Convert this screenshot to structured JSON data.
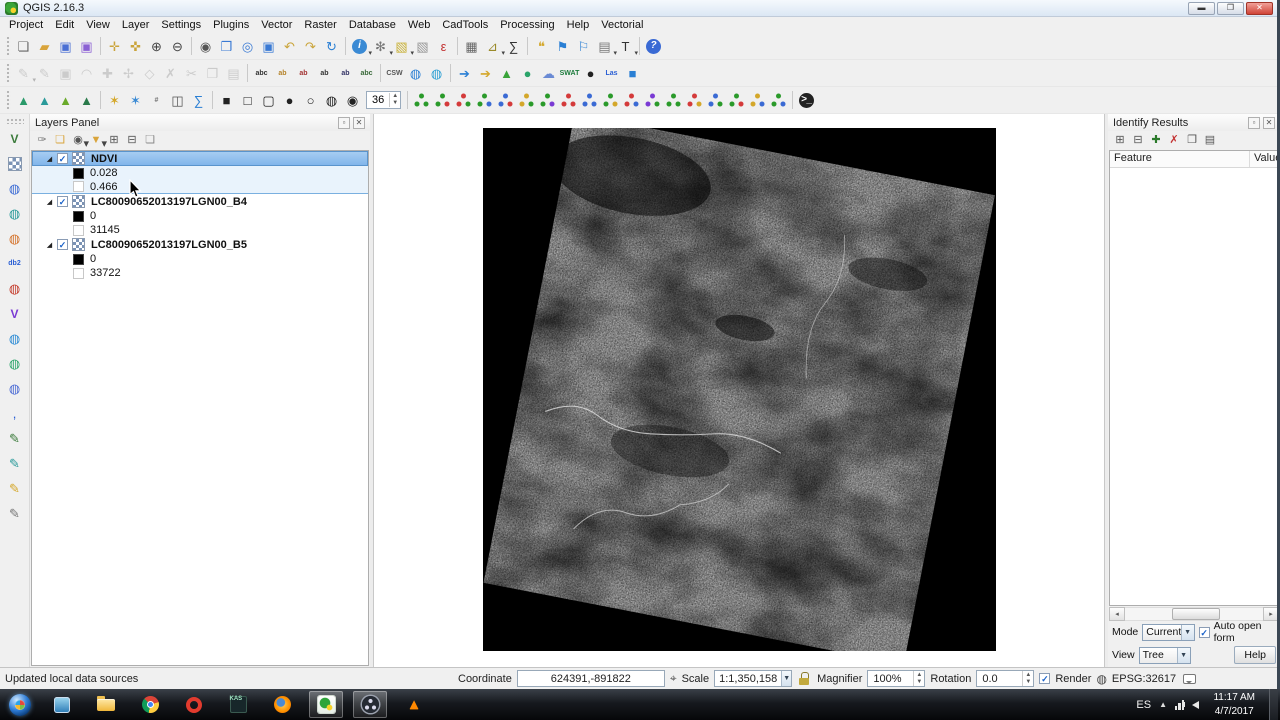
{
  "window": {
    "title": "QGIS 2.16.3"
  },
  "menu": [
    "Project",
    "Edit",
    "View",
    "Layer",
    "Settings",
    "Plugins",
    "Vector",
    "Raster",
    "Database",
    "Web",
    "CadTools",
    "Processing",
    "Help",
    "Vectorial"
  ],
  "colors": {
    "accent": "#2a7fd4",
    "selection": "#7fb4ea",
    "close_button": "#cf4437"
  },
  "toolbars": {
    "row1": [
      {
        "grip": true
      },
      {
        "n": "new-project",
        "g": "❏",
        "c": "#666"
      },
      {
        "n": "open-project",
        "g": "▰",
        "c": "#d9a43b"
      },
      {
        "n": "save-project",
        "g": "▣",
        "c": "#4a6fd4"
      },
      {
        "n": "save-project-as",
        "g": "▣",
        "c": "#8a5fd4"
      },
      {
        "sep": true
      },
      {
        "n": "pan-map",
        "g": "✛",
        "c": "#caa43a"
      },
      {
        "n": "pan-to-selection",
        "g": "✜",
        "c": "#caa43a"
      },
      {
        "n": "zoom-in",
        "g": "⊕",
        "c": "#444"
      },
      {
        "n": "zoom-out",
        "g": "⊖",
        "c": "#444"
      },
      {
        "sep": true
      },
      {
        "n": "zoom-native",
        "g": "◉",
        "c": "#555"
      },
      {
        "n": "zoom-full",
        "g": "❒",
        "c": "#3a7ad4"
      },
      {
        "n": "zoom-to-selection",
        "g": "◎",
        "c": "#3a7ad4"
      },
      {
        "n": "zoom-to-layer",
        "g": "▣",
        "c": "#3a7ad4"
      },
      {
        "n": "zoom-last",
        "g": "↶",
        "c": "#caa43a"
      },
      {
        "n": "zoom-next",
        "g": "↷",
        "c": "#caa43a"
      },
      {
        "n": "refresh-map",
        "g": "↻",
        "c": "#2a7fd4"
      },
      {
        "sep": true
      },
      {
        "n": "identify-features",
        "g": "i",
        "c": "#ffffff",
        "bg": "#3a8ad4",
        "dd": true
      },
      {
        "n": "run-feature-action",
        "g": "✻",
        "c": "#777",
        "dd": true
      },
      {
        "n": "select-features",
        "g": "▧",
        "c": "#c9b23a",
        "dd": true
      },
      {
        "n": "deselect-features",
        "g": "▧",
        "c": "#999"
      },
      {
        "n": "select-by-expression",
        "g": "ε",
        "c": "#c33333"
      },
      {
        "sep": true
      },
      {
        "n": "open-attribute-table",
        "g": "▦",
        "c": "#666"
      },
      {
        "n": "measure-line",
        "g": "⊿",
        "c": "#9a8a2a",
        "dd": true
      },
      {
        "n": "statistical-summary",
        "g": "∑",
        "c": "#333"
      },
      {
        "sep": true
      },
      {
        "n": "map-tips",
        "g": "❝",
        "c": "#d4a72a"
      },
      {
        "n": "new-bookmark",
        "g": "⚑",
        "c": "#2a7fd4"
      },
      {
        "n": "show-bookmarks",
        "g": "⚐",
        "c": "#2a7fd4"
      },
      {
        "n": "new-print-composer",
        "g": "▤",
        "c": "#777",
        "dd": true
      },
      {
        "n": "text-annotation",
        "g": "T",
        "c": "#333",
        "dd": true
      },
      {
        "sep": true
      },
      {
        "n": "help",
        "g": "?",
        "c": "#ffffff",
        "bg": "#3a6ad4"
      }
    ],
    "row2": [
      {
        "grip": true
      },
      {
        "n": "current-edits",
        "g": "✎",
        "c": "#888",
        "dis": true,
        "dd": true
      },
      {
        "n": "toggle-editing",
        "g": "✎",
        "c": "#888",
        "dis": true
      },
      {
        "n": "save-layer-edits",
        "g": "▣",
        "c": "#888",
        "dis": true
      },
      {
        "n": "digitize-with-curve",
        "g": "◠",
        "c": "#888",
        "dis": true
      },
      {
        "n": "add-feature",
        "g": "✚",
        "c": "#888",
        "dis": true
      },
      {
        "n": "move-feature",
        "g": "✢",
        "c": "#888",
        "dis": true
      },
      {
        "n": "node-tool",
        "g": "◇",
        "c": "#888",
        "dis": true
      },
      {
        "n": "delete-selected",
        "g": "✗",
        "c": "#888",
        "dis": true
      },
      {
        "n": "cut-features",
        "g": "✂",
        "c": "#888",
        "dis": true
      },
      {
        "n": "copy-features",
        "g": "❐",
        "c": "#888",
        "dis": true
      },
      {
        "n": "paste-features",
        "g": "▤",
        "c": "#888",
        "dis": true
      },
      {
        "sep": true
      },
      {
        "n": "layer-labeling",
        "g": "abc",
        "txt": true,
        "c": "#333"
      },
      {
        "n": "pin-labels",
        "g": "ab",
        "txt": true,
        "c": "#b5832a"
      },
      {
        "n": "highlight-labels",
        "g": "ab",
        "txt": true,
        "c": "#a33333"
      },
      {
        "n": "move-label",
        "g": "ab",
        "txt": true,
        "c": "#333"
      },
      {
        "n": "rotate-label",
        "g": "ab",
        "txt": true,
        "c": "#336"
      },
      {
        "n": "change-label",
        "g": "abc",
        "txt": true,
        "c": "#3a6a3a"
      },
      {
        "sep": true
      },
      {
        "n": "csw-catalog",
        "g": "CSW",
        "txt": true,
        "c": "#555"
      },
      {
        "n": "metasearch",
        "g": "◍",
        "c": "#2a7fd4"
      },
      {
        "n": "metasearch-services",
        "g": "◍",
        "c": "#2a9fd4"
      },
      {
        "sep": true
      },
      {
        "n": "plugin-import",
        "g": "➔",
        "c": "#2a7fd4"
      },
      {
        "n": "plugin-export",
        "g": "➔",
        "c": "#d4a72a"
      },
      {
        "n": "qgis2web-plugin",
        "g": "▲",
        "c": "#3aa43a"
      },
      {
        "n": "globe-plugin",
        "g": "●",
        "c": "#2aa46a"
      },
      {
        "n": "cloud-plugin",
        "g": "☁",
        "c": "#6a8ad4"
      },
      {
        "n": "swat-plugin",
        "g": "SWAT",
        "txt": true,
        "c": "#1a7a3a"
      },
      {
        "n": "osm-plugin",
        "g": "●",
        "c": "#222"
      },
      {
        "n": "lastools-plugin",
        "g": "Las",
        "txt": true,
        "c": "#2a5fd4"
      },
      {
        "n": "fusion-plugin",
        "g": "■",
        "c": "#2a7fd4"
      }
    ],
    "row3": [
      {
        "grip": true
      },
      {
        "n": "interpolation-tin",
        "g": "▲",
        "c": "#2a9a6a"
      },
      {
        "n": "interpolation-idw",
        "g": "▲",
        "c": "#2a9a9a"
      },
      {
        "n": "terrain-slope",
        "g": "▲",
        "c": "#6aaa2a"
      },
      {
        "n": "terrain-hillshade",
        "g": "▲",
        "c": "#2a7a4a"
      },
      {
        "sep": true
      },
      {
        "n": "heatmap-tool",
        "g": "✶",
        "c": "#d4a72a"
      },
      {
        "n": "zonal-statistics",
        "g": "✶",
        "c": "#3a8ad4"
      },
      {
        "n": "grid-tool",
        "g": "#",
        "txt": true,
        "c": "#777"
      },
      {
        "n": "raster-cube",
        "g": "◫",
        "c": "#555"
      },
      {
        "n": "raster-sum",
        "g": "∑",
        "c": "#2a7fd4"
      },
      {
        "sep": true
      },
      {
        "n": "draw-rect-filled",
        "g": "■",
        "c": "#222"
      },
      {
        "n": "draw-rect",
        "g": "□",
        "c": "#222"
      },
      {
        "n": "draw-rounded-rect",
        "g": "▢",
        "c": "#222"
      },
      {
        "n": "draw-ellipse-filled",
        "g": "●",
        "c": "#222"
      },
      {
        "n": "draw-ellipse",
        "g": "○",
        "c": "#222"
      },
      {
        "n": "draw-circle",
        "g": "◍",
        "c": "#222"
      },
      {
        "n": "draw-spiral",
        "g": "◉",
        "c": "#222"
      },
      {
        "spin": "36",
        "n": "angle-spinbox"
      },
      {
        "sep": true
      },
      {
        "n": "geometry-tool-1",
        "dots": true,
        "c1": "#2a9a2a",
        "c2": "#2a9a2a"
      },
      {
        "n": "geometry-tool-2",
        "dots": true,
        "c1": "#2a9a2a",
        "c2": "#d43a3a"
      },
      {
        "n": "geometry-tool-3",
        "dots": true,
        "c1": "#d43a3a",
        "c2": "#2a9a2a"
      },
      {
        "n": "geometry-tool-4",
        "dots": true,
        "c1": "#2a9a2a",
        "c2": "#3a6ad4"
      },
      {
        "n": "geometry-tool-5",
        "dots": true,
        "c1": "#3a6ad4",
        "c2": "#d43a3a"
      },
      {
        "n": "geometry-tool-6",
        "dots": true,
        "c1": "#d4a72a",
        "c2": "#2a9a2a"
      },
      {
        "n": "geometry-tool-7",
        "dots": true,
        "c1": "#2a9a2a",
        "c2": "#7a3ad4"
      },
      {
        "n": "geometry-tool-8",
        "dots": true,
        "c1": "#d43a3a",
        "c2": "#d43a3a"
      },
      {
        "n": "geometry-tool-9",
        "dots": true,
        "c1": "#3a6ad4",
        "c2": "#3a6ad4"
      },
      {
        "n": "geometry-tool-10",
        "dots": true,
        "c1": "#2a9a2a",
        "c2": "#d4a72a"
      },
      {
        "n": "geometry-tool-11",
        "dots": true,
        "c1": "#d43a3a",
        "c2": "#3a6ad4"
      },
      {
        "n": "geometry-tool-12",
        "dots": true,
        "c1": "#7a3ad4",
        "c2": "#2a9a2a"
      },
      {
        "n": "geometry-tool-13",
        "dots": true,
        "c1": "#2a9a2a",
        "c2": "#2a9a2a"
      },
      {
        "n": "geometry-tool-14",
        "dots": true,
        "c1": "#d43a3a",
        "c2": "#d4a72a"
      },
      {
        "n": "geometry-tool-15",
        "dots": true,
        "c1": "#3a6ad4",
        "c2": "#2a9a2a"
      },
      {
        "n": "geometry-tool-16",
        "dots": true,
        "c1": "#2a9a2a",
        "c2": "#d43a3a"
      },
      {
        "n": "geometry-tool-17",
        "dots": true,
        "c1": "#d4a72a",
        "c2": "#3a6ad4"
      },
      {
        "n": "geometry-tool-18",
        "dots": true,
        "c1": "#2a9a2a",
        "c2": "#3a6ad4"
      },
      {
        "sep": true
      },
      {
        "n": "python-console",
        "g": ">_",
        "txt": true,
        "c": "#ffffff",
        "bg": "#222222"
      }
    ],
    "left": [
      {
        "n": "add-vector-layer",
        "g": "V",
        "txt2": true,
        "c": "#3a7a3a"
      },
      {
        "n": "add-raster-layer",
        "checker": true
      },
      {
        "n": "add-postgis-layer",
        "g": "◍",
        "c": "#3a6ad4"
      },
      {
        "n": "add-spatialite-layer",
        "g": "◍",
        "c": "#2a9a9a"
      },
      {
        "n": "add-mssql-layer",
        "g": "◍",
        "c": "#d4722a"
      },
      {
        "n": "add-db2-layer",
        "g": "db2",
        "txt": true,
        "c": "#2a5fd4"
      },
      {
        "n": "add-oracle-layer",
        "g": "◍",
        "c": "#c43a2a"
      },
      {
        "n": "add-virtual-layer",
        "g": "V",
        "txt2": true,
        "c": "#7a3ad4"
      },
      {
        "n": "add-wms-layer",
        "g": "◍",
        "c": "#2a8ad4"
      },
      {
        "n": "add-wcs-layer",
        "g": "◍",
        "c": "#2aa46a"
      },
      {
        "n": "add-wfs-layer",
        "g": "◍",
        "c": "#4a6ad4"
      },
      {
        "n": "add-delimited-text-layer",
        "g": ",",
        "c": "#2a5fd4"
      },
      {
        "n": "new-shapefile-layer",
        "g": "✎",
        "c": "#3a7a3a"
      },
      {
        "n": "new-spatialite-layer",
        "g": "✎",
        "c": "#2a9a9a"
      },
      {
        "n": "new-geopackage-layer",
        "g": "✎",
        "c": "#d4a72a"
      },
      {
        "n": "new-memory-layer",
        "g": "✎",
        "c": "#777"
      }
    ]
  },
  "layers_panel": {
    "title": "Layers Panel",
    "toolbar": [
      {
        "n": "open-layer-styling",
        "g": "✑",
        "c": "#777"
      },
      {
        "n": "add-group",
        "g": "❏",
        "c": "#d9a43b"
      },
      {
        "n": "manage-visibility",
        "g": "◉",
        "c": "#555",
        "dd": true
      },
      {
        "n": "filter-legend",
        "g": "▼",
        "c": "#d9a43b",
        "dd": true
      },
      {
        "n": "expand-all",
        "g": "⊞",
        "c": "#555"
      },
      {
        "n": "collapse-all",
        "g": "⊟",
        "c": "#555"
      },
      {
        "n": "remove-layer",
        "g": "❏",
        "c": "#888"
      }
    ],
    "layers": [
      {
        "name": "NDVI",
        "checked": true,
        "selected": true,
        "legend": [
          {
            "swatch": "#000000",
            "value": "0.028"
          },
          {
            "swatch": "#ffffff",
            "value": "0.466"
          }
        ]
      },
      {
        "name": "LC80090652013197LGN00_B4",
        "checked": true,
        "selected": false,
        "legend": [
          {
            "swatch": "#000000",
            "value": "0"
          },
          {
            "swatch": "#ffffff",
            "value": "31145"
          }
        ]
      },
      {
        "name": "LC80090652013197LGN00_B5",
        "checked": true,
        "selected": false,
        "legend": [
          {
            "swatch": "#000000",
            "value": "0"
          },
          {
            "swatch": "#ffffff",
            "value": "33722"
          }
        ]
      }
    ]
  },
  "identify_panel": {
    "title": "Identify Results",
    "toolbar": [
      {
        "n": "expand-tree",
        "g": "⊞",
        "c": "#555"
      },
      {
        "n": "collapse-tree",
        "g": "⊟",
        "c": "#555"
      },
      {
        "n": "expand-new-results",
        "g": "✚",
        "c": "#2a7a2a"
      },
      {
        "n": "clear-results",
        "g": "✗",
        "c": "#c33333"
      },
      {
        "n": "copy-feature",
        "g": "❐",
        "c": "#555"
      },
      {
        "n": "print-response",
        "g": "▤",
        "c": "#555"
      }
    ],
    "columns": [
      "Feature",
      "Value"
    ],
    "mode_label": "Mode",
    "mode_value": "Current la",
    "auto_open_label": "Auto open form",
    "auto_open_checked": true,
    "view_label": "View",
    "view_value": "Tree",
    "help_label": "Help"
  },
  "status_bar": {
    "message": "Updated local data sources",
    "coordinate_label": "Coordinate",
    "coordinate_value": "624391,-891822",
    "scale_label": "Scale",
    "scale_value": "1:1,350,158",
    "magnifier_label": "Magnifier",
    "magnifier_value": "100%",
    "rotation_label": "Rotation",
    "rotation_value": "0.0",
    "render_label": "Render",
    "render_checked": true,
    "epsg": "EPSG:32617"
  },
  "taskbar": {
    "icons": [
      {
        "n": "blue-app",
        "kind": "blueapp"
      },
      {
        "n": "explorer",
        "kind": "explorer"
      },
      {
        "n": "chrome",
        "kind": "chrome"
      },
      {
        "n": "opera",
        "kind": "opera"
      },
      {
        "n": "kaspersky",
        "kind": "kas",
        "text": "KAS"
      },
      {
        "n": "firefox",
        "kind": "firefox"
      },
      {
        "n": "qgis",
        "kind": "qgis",
        "active": true
      },
      {
        "n": "obs",
        "kind": "obs",
        "active": true
      },
      {
        "n": "vlc",
        "kind": "vlc",
        "text": "▲"
      }
    ],
    "lang": "ES",
    "time": "11:17 AM",
    "date": "4/7/2017"
  }
}
